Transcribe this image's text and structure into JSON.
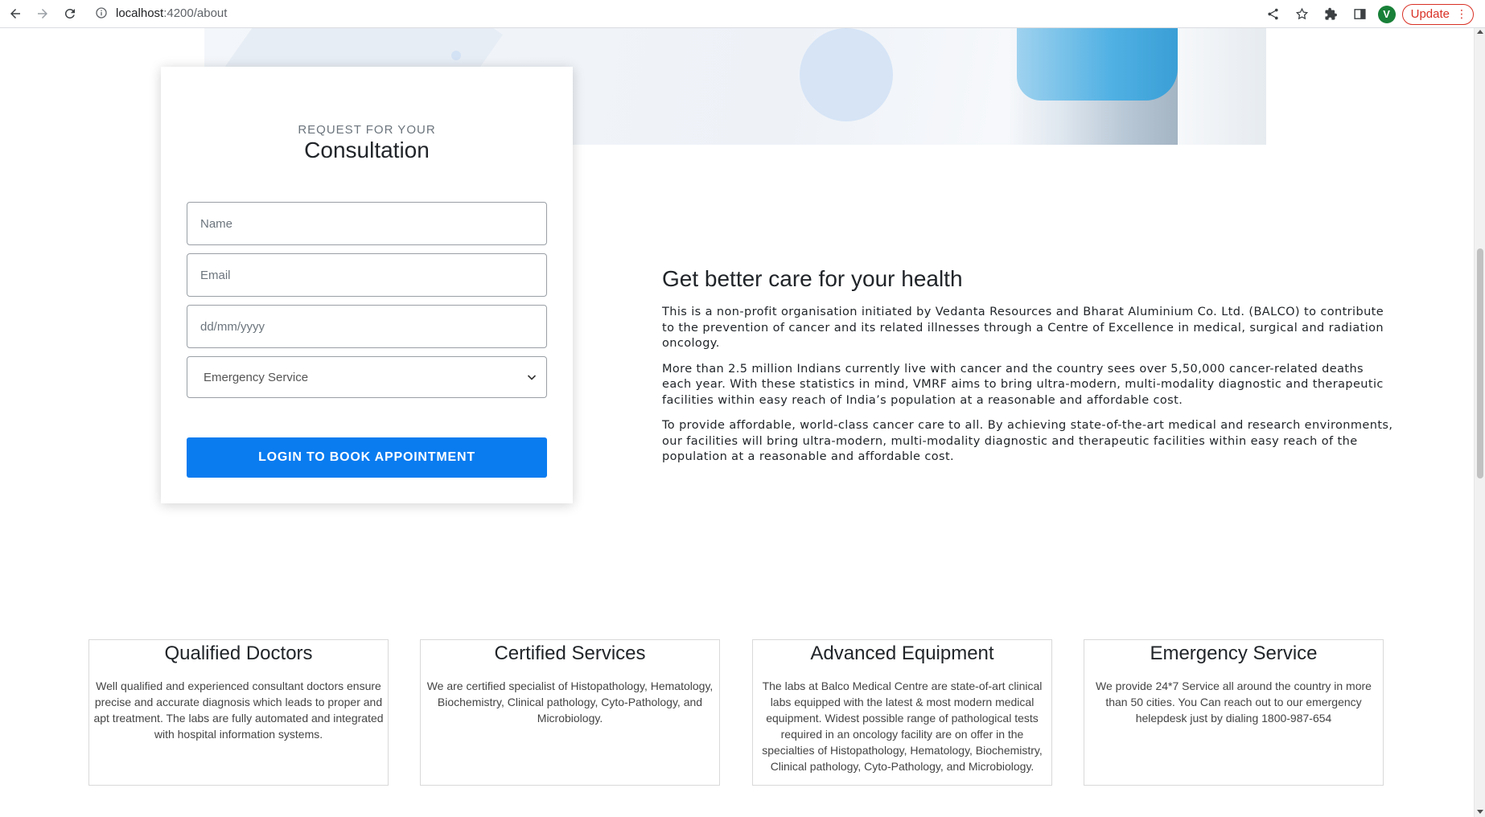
{
  "browser": {
    "url_host": "localhost",
    "url_path": ":4200/about",
    "avatar_letter": "V",
    "update_label": "Update"
  },
  "consultation": {
    "eyebrow": "REQUEST FOR YOUR",
    "title": "Consultation",
    "name_placeholder": "Name",
    "email_placeholder": "Email",
    "date_placeholder": "dd/mm/yyyy",
    "service_selected": "Emergency Service",
    "submit_label": "LOGIN TO BOOK APPOINTMENT"
  },
  "about": {
    "heading": "Get better care for your health",
    "paragraphs": [
      "This is a non-profit organisation initiated by Vedanta Resources and Bharat Aluminium Co. Ltd. (BALCO) to contribute to the prevention of cancer and its related illnesses through a Centre of Excellence in medical, surgical and radiation oncology.",
      "More than 2.5 million Indians currently live with cancer and the country sees over 5,50,000 cancer-related deaths each year. With these statistics in mind, VMRF aims to bring ultra-modern, multi-modality diagnostic and therapeutic facilities within easy reach of India’s population at a reasonable and affordable cost.",
      "To provide affordable, world-class cancer care to all. By achieving state-of-the-art medical and research environments, our facilities will bring ultra-modern, multi-modality diagnostic and therapeutic facilities within easy reach of the population at a reasonable and affordable cost."
    ]
  },
  "features": [
    {
      "title": "Qualified Doctors",
      "text": "Well qualified and experienced consultant doctors ensure precise and accurate diagnosis which leads to proper and apt treatment. The labs are fully automated and integrated with hospital information systems."
    },
    {
      "title": "Certified Services",
      "text": "We are certified specialist of Histopathology, Hematology, Biochemistry, Clinical pathology, Cyto-Pathology, and Microbiology."
    },
    {
      "title": "Advanced Equipment",
      "text": "The labs at Balco Medical Centre are state-of-art clinical labs equipped with the latest & most modern medical equipment. Widest possible range of pathological tests required in an oncology facility are on offer in the specialties of Histopathology, Hematology, Biochemistry, Clinical pathology, Cyto-Pathology, and Microbiology."
    },
    {
      "title": "Emergency Service",
      "text": "We provide 24*7 Service all around the country in more than 50 cities. You Can reach out to our emergency helepdesk just by dialing 1800-987-654"
    }
  ]
}
